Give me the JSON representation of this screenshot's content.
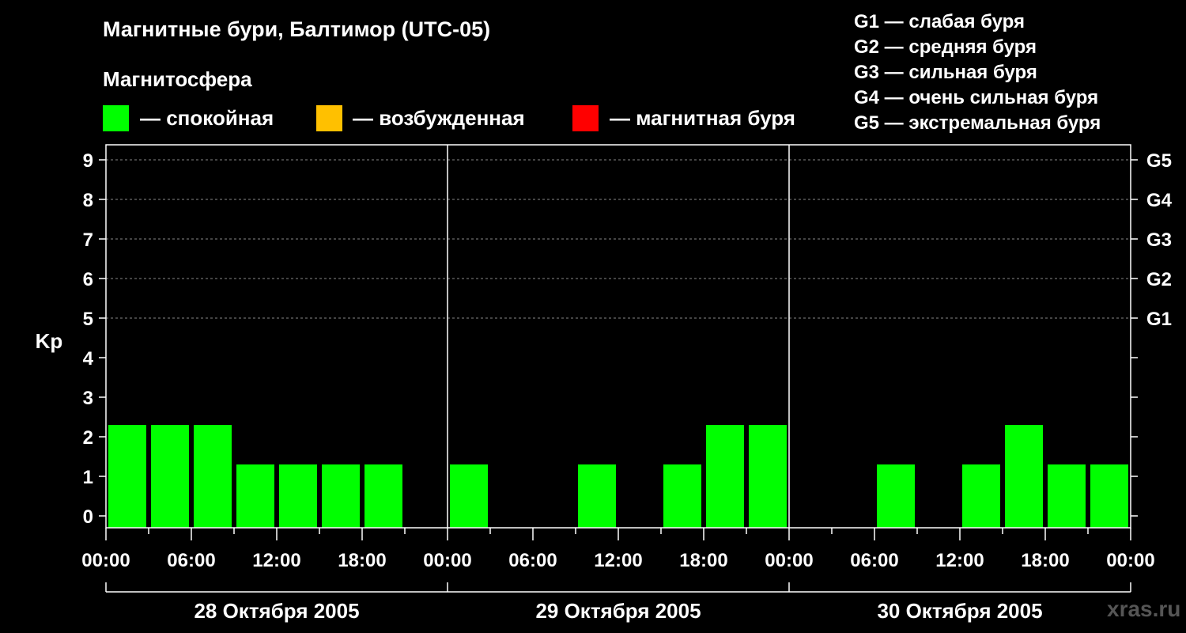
{
  "header": {
    "title": "Магнитные бури, Балтимор (UTC-05)",
    "subtitle": "Магнитосфера"
  },
  "legend": [
    {
      "label": "— спокойная",
      "color": "#00ff00"
    },
    {
      "label": "— возбужденная",
      "color": "#ffc000"
    },
    {
      "label": "— магнитная буря",
      "color": "#ff0000"
    }
  ],
  "g_legend": [
    "G1 — слабая буря",
    "G2 — средняя буря",
    "G3 — сильная буря",
    "G4 — очень сильная буря",
    "G5 — экстремальная буря"
  ],
  "watermark": "xras.ru",
  "chart_data": {
    "type": "bar",
    "ylabel": "Kp",
    "ylim": [
      0,
      9
    ],
    "yticks": [
      "0",
      "1",
      "2",
      "3",
      "4",
      "5",
      "6",
      "7",
      "8",
      "9"
    ],
    "right_ticks": [
      {
        "kp": 5,
        "label": "G1"
      },
      {
        "kp": 6,
        "label": "G2"
      },
      {
        "kp": 7,
        "label": "G3"
      },
      {
        "kp": 8,
        "label": "G4"
      },
      {
        "kp": 9,
        "label": "G5"
      }
    ],
    "xtick_labels": [
      "00:00",
      "06:00",
      "12:00",
      "18:00",
      "00:00",
      "06:00",
      "12:00",
      "18:00",
      "00:00",
      "06:00",
      "12:00",
      "18:00",
      "00:00"
    ],
    "days": [
      "28 Октября 2005",
      "29 Октября 2005",
      "30 Октября 2005"
    ],
    "interval_hours": 3,
    "values": [
      2,
      2,
      2,
      1,
      1,
      1,
      1,
      0,
      1,
      0,
      0,
      1,
      0,
      1,
      2,
      2,
      0,
      0,
      1,
      0,
      1,
      2,
      1,
      1
    ],
    "grid": "dashed-horizontal",
    "bar_colors": {
      "quiet": "#00ff00"
    }
  }
}
